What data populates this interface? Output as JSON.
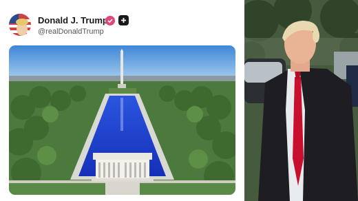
{
  "post": {
    "author_name": "Donald J. Trump",
    "author_handle": "@realDonaldTrump",
    "verified_icon": "check-badge-icon",
    "extra_icon": "plus-badge-icon"
  },
  "media": {
    "subject": "reflecting-pool-image"
  },
  "video": {
    "subject": "speaker-video"
  },
  "colors": {
    "badge_pink": "#e0457b",
    "pool_blue": "#1f3fd1",
    "tie_red": "#c8102e"
  }
}
